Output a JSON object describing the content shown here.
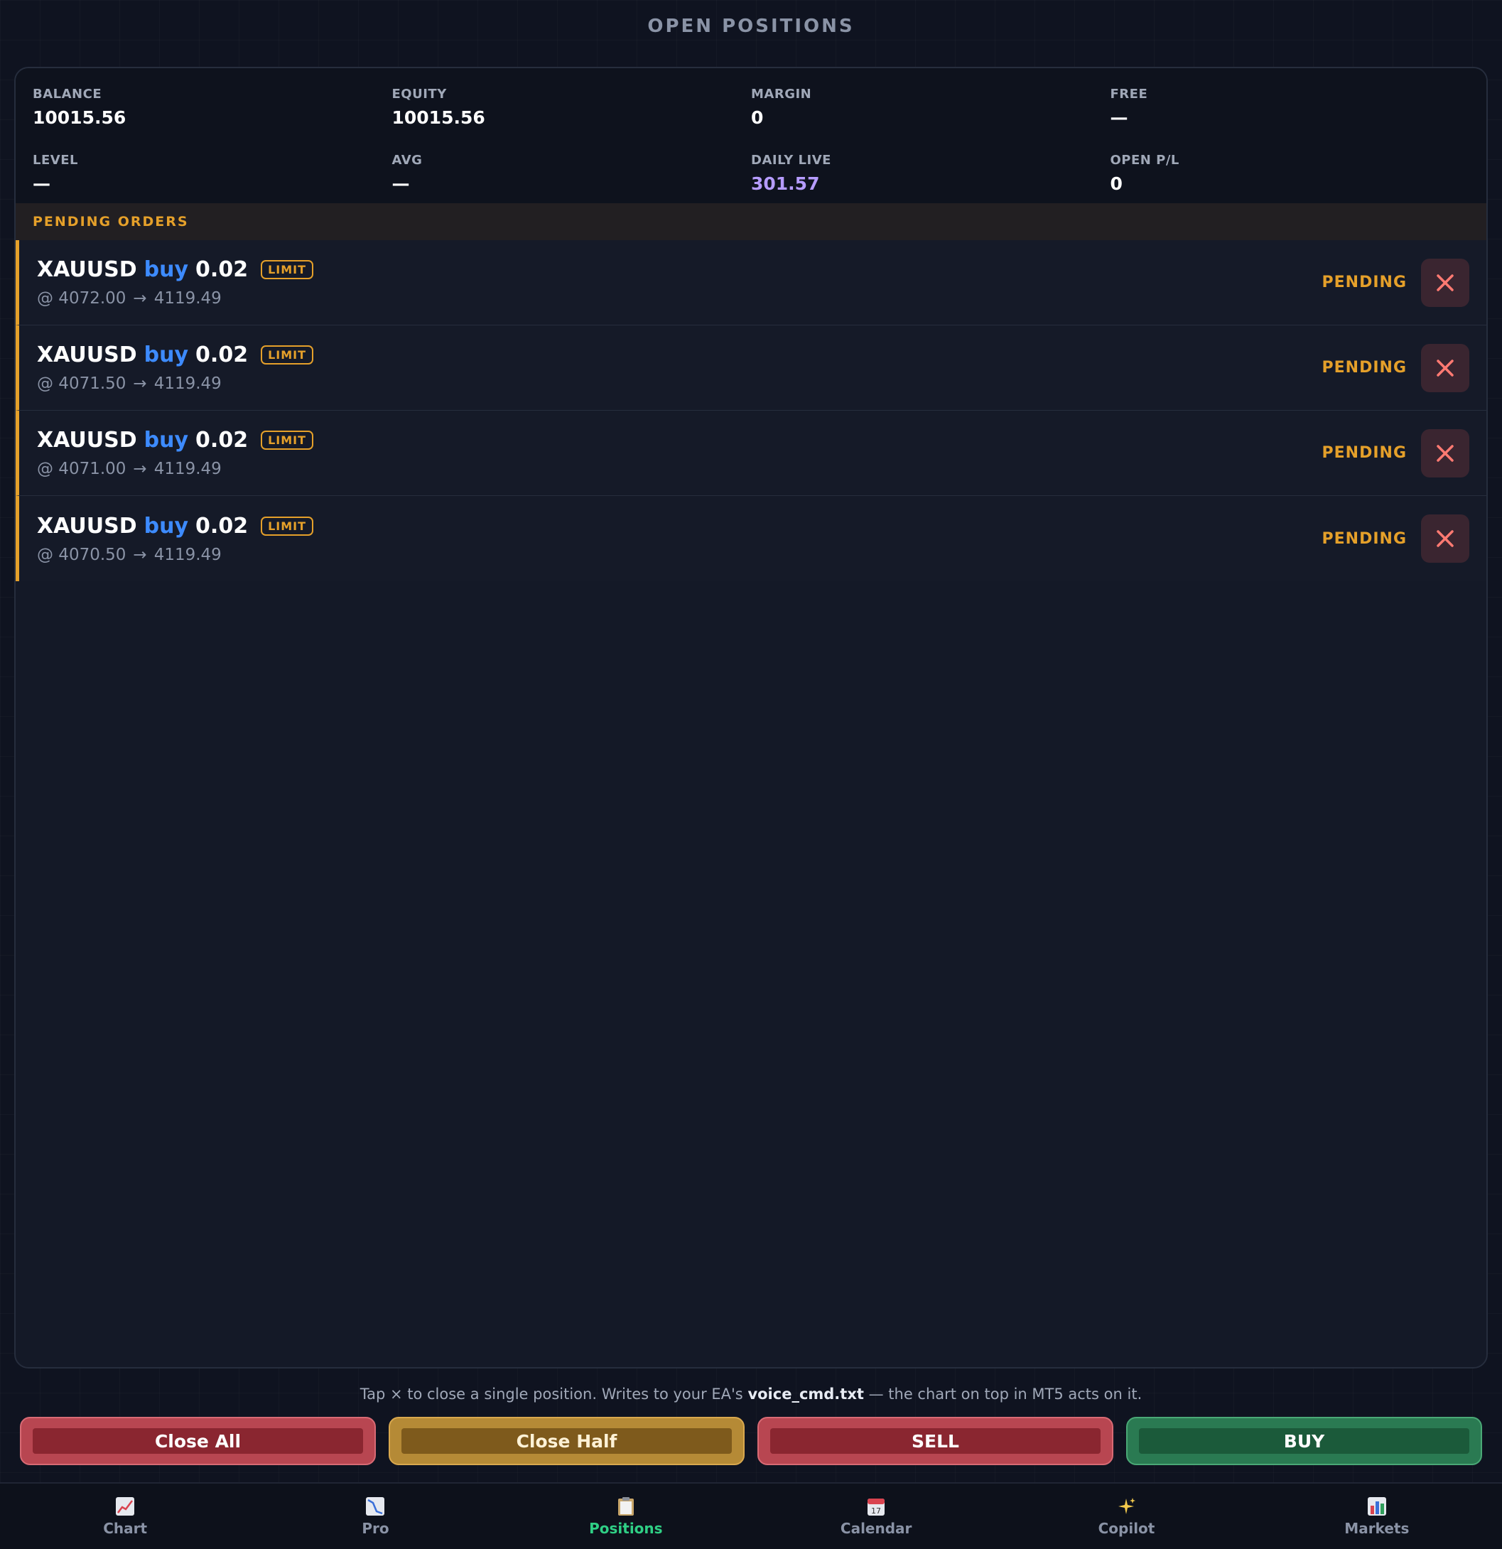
{
  "header": {
    "title": "OPEN POSITIONS"
  },
  "stats": [
    {
      "label": "BALANCE",
      "value": "10015.56"
    },
    {
      "label": "EQUITY",
      "value": "10015.56"
    },
    {
      "label": "MARGIN",
      "value": "0"
    },
    {
      "label": "FREE",
      "value": "—"
    },
    {
      "label": "LEVEL",
      "value": "—"
    },
    {
      "label": "AVG",
      "value": "—"
    },
    {
      "label": "DAILY LIVE",
      "value": "301.57"
    },
    {
      "label": "OPEN P/L",
      "value": "0"
    }
  ],
  "pending": {
    "header": "PENDING ORDERS",
    "orders": [
      {
        "symbol": "XAUUSD",
        "side": "buy",
        "lots": "0.02",
        "type": "LIMIT",
        "at": "@ 4072.00",
        "arrow": "→",
        "target": "4119.49",
        "status": "PENDING"
      },
      {
        "symbol": "XAUUSD",
        "side": "buy",
        "lots": "0.02",
        "type": "LIMIT",
        "at": "@ 4071.50",
        "arrow": "→",
        "target": "4119.49",
        "status": "PENDING"
      },
      {
        "symbol": "XAUUSD",
        "side": "buy",
        "lots": "0.02",
        "type": "LIMIT",
        "at": "@ 4071.00",
        "arrow": "→",
        "target": "4119.49",
        "status": "PENDING"
      },
      {
        "symbol": "XAUUSD",
        "side": "buy",
        "lots": "0.02",
        "type": "LIMIT",
        "at": "@ 4070.50",
        "arrow": "→",
        "target": "4119.49",
        "status": "PENDING"
      }
    ]
  },
  "footnote": {
    "prefix": "Tap × to close a single position. Writes to your EA's",
    "file": "voice_cmd.txt",
    "suffix": "— the chart on top in MT5 acts on it."
  },
  "actions": {
    "close_all": "Close All",
    "close_half": "Close Half",
    "sell": "SELL",
    "buy": "BUY"
  },
  "tabs": [
    {
      "label": "Chart",
      "icon": "chart-icon"
    },
    {
      "label": "Pro",
      "icon": "pro-chart-icon"
    },
    {
      "label": "Positions",
      "icon": "clipboard-icon"
    },
    {
      "label": "Calendar",
      "icon": "calendar-icon"
    },
    {
      "label": "Copilot",
      "icon": "sparkles-icon"
    },
    {
      "label": "Markets",
      "icon": "bar-chart-icon"
    }
  ],
  "colors": {
    "accent_pending": "#e5a02a",
    "buy": "#3d8bff",
    "daily_live": "#b69cff",
    "active_tab": "#2fcf85"
  }
}
